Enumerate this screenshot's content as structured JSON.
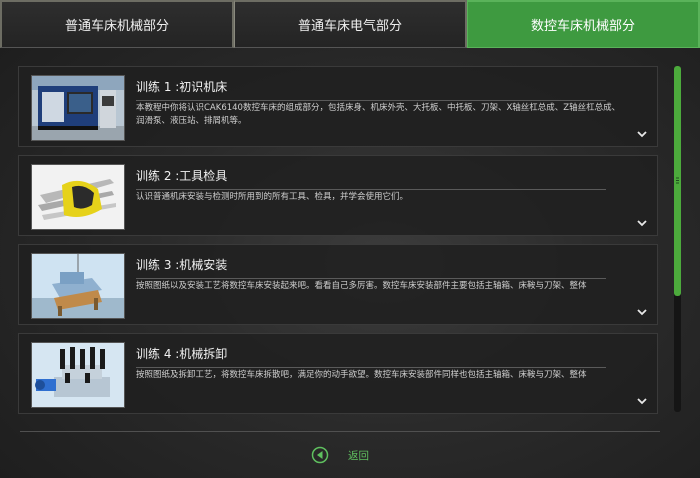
{
  "tabs": [
    {
      "label": "普通车床机械部分",
      "active": false
    },
    {
      "label": "普通车床电气部分",
      "active": false
    },
    {
      "label": "数控车床机械部分",
      "active": true
    }
  ],
  "trainings": [
    {
      "title": "训练 1 :初识机床",
      "description": "本教程中你将认识CAK6140数控车床的组成部分，包括床身、机床外壳、大托板、中托板、刀架、X轴丝杠总成、Z轴丝杠总成、润滑泵、液压站、排屑机等。",
      "thumbnail_icon": "cnc-machine-image"
    },
    {
      "title": "训练 2 :工具检具",
      "description": "认识普通机床安装与检测时所用到的所有工具、检具，并学会使用它们。",
      "thumbnail_icon": "hex-key-set-image"
    },
    {
      "title": "训练 3 :机械安装",
      "description": "按照图纸以及安装工艺将数控车床安装起来吧。看看自己多厉害。数控车床安装部件主要包括主轴箱、床鞍与刀架、整体",
      "thumbnail_icon": "assembly-scene-image"
    },
    {
      "title": "训练 4 :机械拆卸",
      "description": "按照图纸及拆卸工艺，将数控车床拆散吧，满足你的动手欲望。数控车床安装部件同样也包括主轴箱、床鞍与刀架、整体",
      "thumbnail_icon": "disassembly-image"
    }
  ],
  "footer": {
    "back_label": "返回",
    "back_icon": "back-arrow-icon"
  },
  "colors": {
    "accent_green": "#3e9a40",
    "scrollbar_green": "#4caa3c",
    "link_green": "#5fc05f"
  }
}
